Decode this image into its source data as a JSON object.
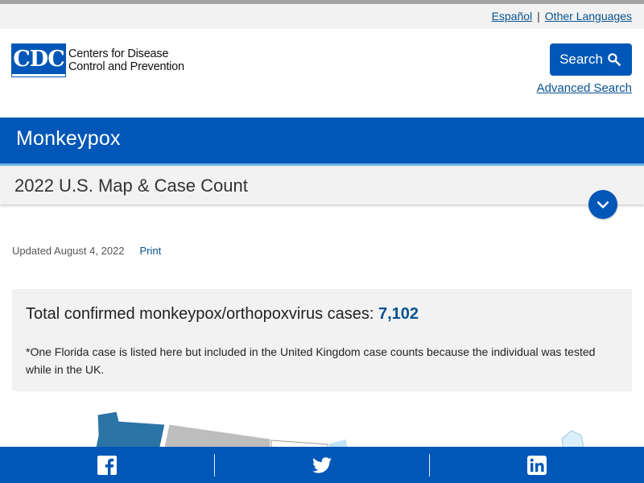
{
  "lang": {
    "spanish": "Español",
    "separator": "|",
    "other": "Other Languages"
  },
  "logo": {
    "mark": "CDC",
    "line1": "Centers for Disease",
    "line2": "Control and Prevention"
  },
  "search": {
    "button_label": "Search",
    "advanced_label": "Advanced Search"
  },
  "page": {
    "site_title": "Monkeypox",
    "section_title": "2022 U.S. Map & Case Count",
    "updated": "Updated August 4, 2022",
    "print_label": "Print"
  },
  "callout": {
    "total_label": "Total confirmed monkeypox/orthopoxvirus cases: ",
    "total_value": "7,102",
    "note": "*One Florida case is listed here but included in the United Kingdom case counts because the individual was tested while in the UK."
  },
  "share": {
    "items": [
      "facebook-icon",
      "twitter-icon",
      "linkedin-icon"
    ]
  },
  "colors": {
    "brand_blue": "#0057b7",
    "link_blue": "#075290",
    "accent_light_blue": "#6cb6e4",
    "panel_gray": "#f2f2f2"
  }
}
